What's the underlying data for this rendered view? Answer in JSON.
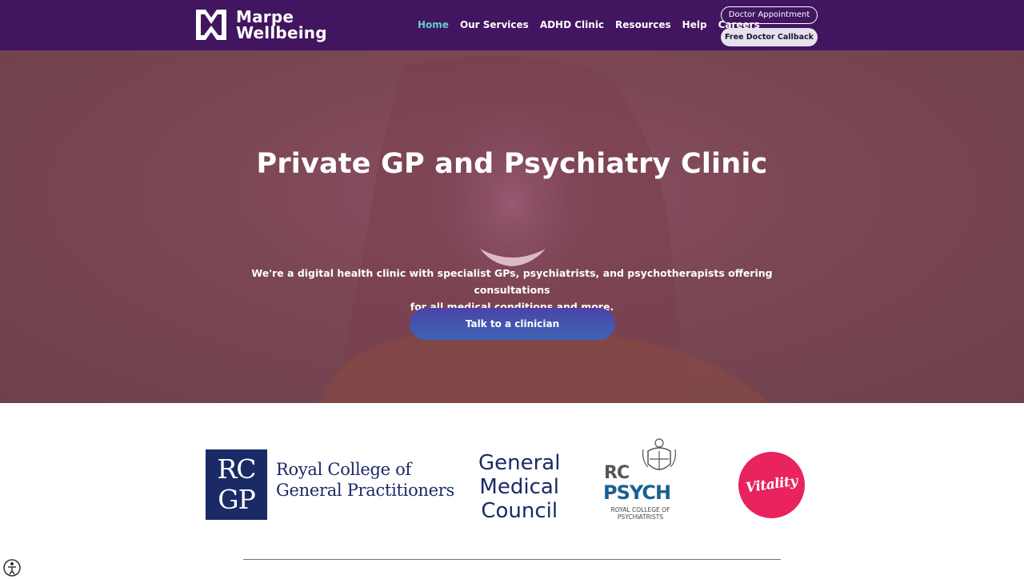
{
  "brand": {
    "line1": "Marpe",
    "line2": "Wellbeing",
    "logo_icon": "mw-logo-icon"
  },
  "nav": {
    "items": [
      {
        "label": "Home",
        "active": true
      },
      {
        "label": "Our Services",
        "active": false
      },
      {
        "label": "ADHD Clinic",
        "active": false
      },
      {
        "label": "Resources",
        "active": false
      },
      {
        "label": "Help",
        "active": false
      },
      {
        "label": "Careers",
        "active": false
      }
    ],
    "appointment_label": "Doctor Appointment",
    "callback_label": "Free Doctor Callback"
  },
  "hero": {
    "title": "Private GP and Psychiatry Clinic",
    "subtitle_line1": "We're a digital health clinic with specialist GPs, psychiatrists, and psychotherapists offering consultations",
    "subtitle_line2": "for  all medical conditions and more.",
    "cta_label": "Talk to a clinician"
  },
  "accreditations": {
    "rcgp": {
      "monogram_top": "RC",
      "monogram_bottom": "GP",
      "name_line1": "Royal College of",
      "name_line2": "General Practitioners"
    },
    "gmc": {
      "line1": "General",
      "line2": "Medical",
      "line3": "Council"
    },
    "rcpsych": {
      "rc": "RC",
      "psych": "PSYCH",
      "small_line1": "ROYAL COLLEGE OF",
      "small_line2": "PSYCHIATRISTS"
    },
    "vitality": {
      "label": "Vitality"
    }
  },
  "colors": {
    "header_bg": "#421560",
    "nav_active": "#5ed0c2",
    "navy": "#1a2a66",
    "vitality_pink": "#e8235d"
  }
}
